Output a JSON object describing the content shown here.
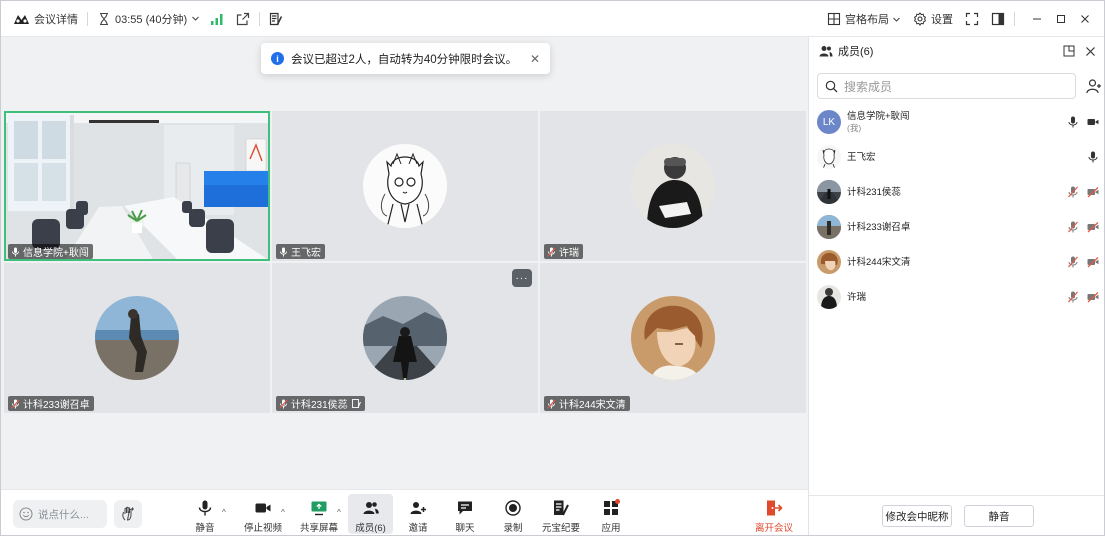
{
  "titlebar": {
    "meeting_details": "会议详情",
    "timer": "03:55 (40分钟)",
    "layout_label": "宫格布局",
    "settings_label": "设置"
  },
  "toast": {
    "message": "会议已超过2人，自动转为40分钟限时会议。"
  },
  "tiles": [
    {
      "name": "信息学院+耿闯"
    },
    {
      "name": "王飞宏"
    },
    {
      "name": "许瑞"
    },
    {
      "name": "计科233谢召卓"
    },
    {
      "name": "计科231侯蕊"
    },
    {
      "name": "计科244宋文清"
    }
  ],
  "bottombar": {
    "chat_placeholder": "说点什么...",
    "mute": "静音",
    "stop_video": "停止视频",
    "share_screen": "共享屏幕",
    "members": "成员(6)",
    "invite": "邀请",
    "chat": "聊天",
    "record": "录制",
    "yuanbao": "元宝纪要",
    "apps": "应用",
    "leave": "离开会议"
  },
  "panel": {
    "title": "成员(6)",
    "search_placeholder": "搜索成员",
    "members": [
      {
        "name": "信息学院+耿闯",
        "sub": "(我)",
        "initials": "LK"
      },
      {
        "name": "王飞宏"
      },
      {
        "name": "计科231侯蕊"
      },
      {
        "name": "计科233谢召卓"
      },
      {
        "name": "计科244宋文清"
      },
      {
        "name": "许瑞"
      }
    ],
    "rename_button": "修改会中昵称",
    "mute_button": "静音"
  },
  "colors": {
    "accent": "#3fc07a",
    "leave": "#e04a2c",
    "info": "#1f6feb",
    "muted": "#e05a4a"
  }
}
